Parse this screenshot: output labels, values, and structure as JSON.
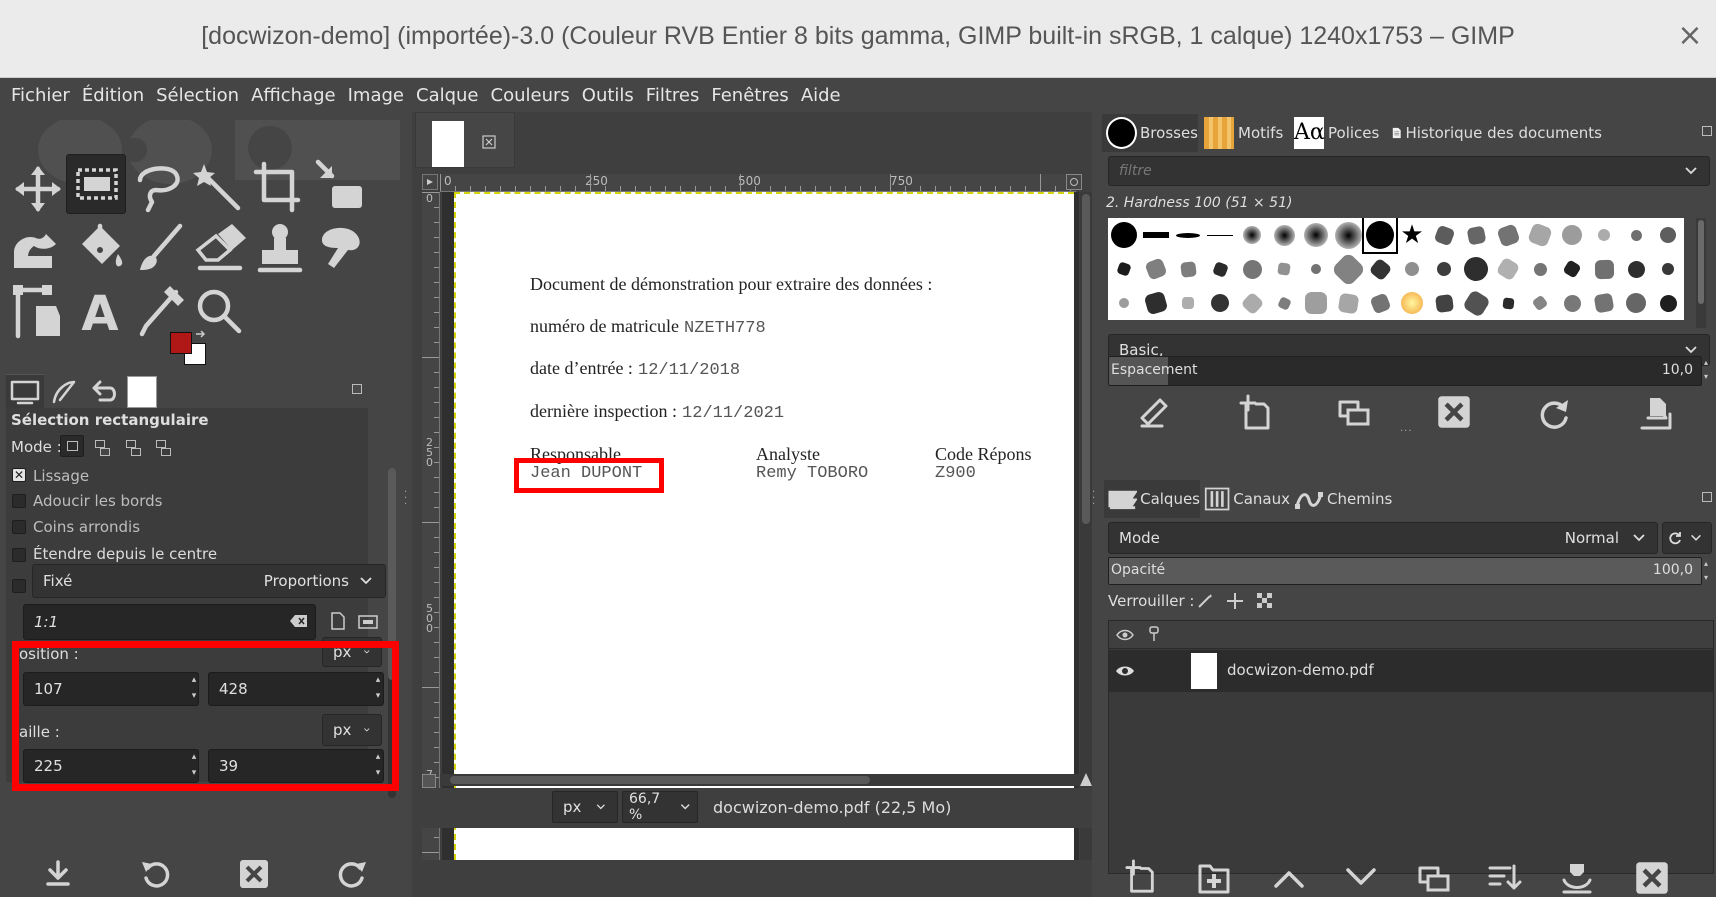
{
  "window": {
    "title": "[docwizon-demo] (importée)-3.0 (Couleur RVB Entier 8 bits gamma, GIMP built-in sRGB, 1 calque) 1240x1753 – GIMP",
    "close_glyph": "×"
  },
  "menubar": [
    "Fichier",
    "Édition",
    "Sélection",
    "Affichage",
    "Image",
    "Calque",
    "Couleurs",
    "Outils",
    "Filtres",
    "Fenêtres",
    "Aide"
  ],
  "colors": {
    "foreground": "#b01818",
    "background": "#ffffff",
    "highlight": "#ff0000"
  },
  "tool_options": {
    "title": "Sélection rectangulaire",
    "mode_label": "Mode :",
    "antialias": {
      "label": "Lissage",
      "checked": true,
      "mark": "✕"
    },
    "feather": {
      "label": "Adoucir les bords",
      "checked": false
    },
    "rounded": {
      "label": "Coins arrondis",
      "checked": false
    },
    "expand": {
      "label": "Étendre depuis le centre",
      "checked": false
    },
    "fixed_label": "Fixé",
    "fixed_option": "Proportions",
    "ratio_value": "1:1",
    "position_label": "osition :",
    "position_unit": "px",
    "position_x": "107",
    "position_y": "428",
    "size_label": "aille :",
    "size_unit": "px",
    "size_w": "225",
    "size_h": "39"
  },
  "canvas": {
    "ruler_h": [
      "0",
      "250",
      "500",
      "750"
    ],
    "ruler_v": [
      "0",
      "250",
      "500",
      "750"
    ],
    "doc": {
      "intro": "Document de démonstration pour extraire des données :",
      "matricule_label": "numéro de matricule",
      "matricule_value": "NZETH778",
      "entry_label": "date d’entrée :",
      "entry_value": "12/11/2018",
      "inspection_label": "dernière inspection :",
      "inspection_value": "12/11/2021",
      "col1_header": "Responsable",
      "col1_value": "Jean DUPONT",
      "col2_header": "Analyste",
      "col2_value": "Remy TOBORO",
      "col3_header": "Code Répons",
      "col3_value": "Z900"
    },
    "unit": "px",
    "zoom": "66,7 %",
    "status": "docwizon-demo.pdf (22,5 Mo)"
  },
  "brushes_dock": {
    "tabs": [
      "Brosses",
      "Motifs",
      "Polices",
      "Historique des documents"
    ],
    "filter_placeholder": "filtre",
    "brush_name": "2. Hardness 100 (51 × 51)",
    "preset": "Basic,",
    "spacing_label": "Espacement",
    "spacing_value": "10,0",
    "spacing_fraction": 0.1
  },
  "layers_dock": {
    "tabs": [
      "Calques",
      "Canaux",
      "Chemins"
    ],
    "mode_label": "Mode",
    "mode_value": "Normal",
    "opacity_label": "Opacité",
    "opacity_value": "100,0",
    "opacity_fraction": 1.0,
    "lock_label": "Verrouiller :",
    "layer_name": "docwizon-demo.pdf"
  }
}
